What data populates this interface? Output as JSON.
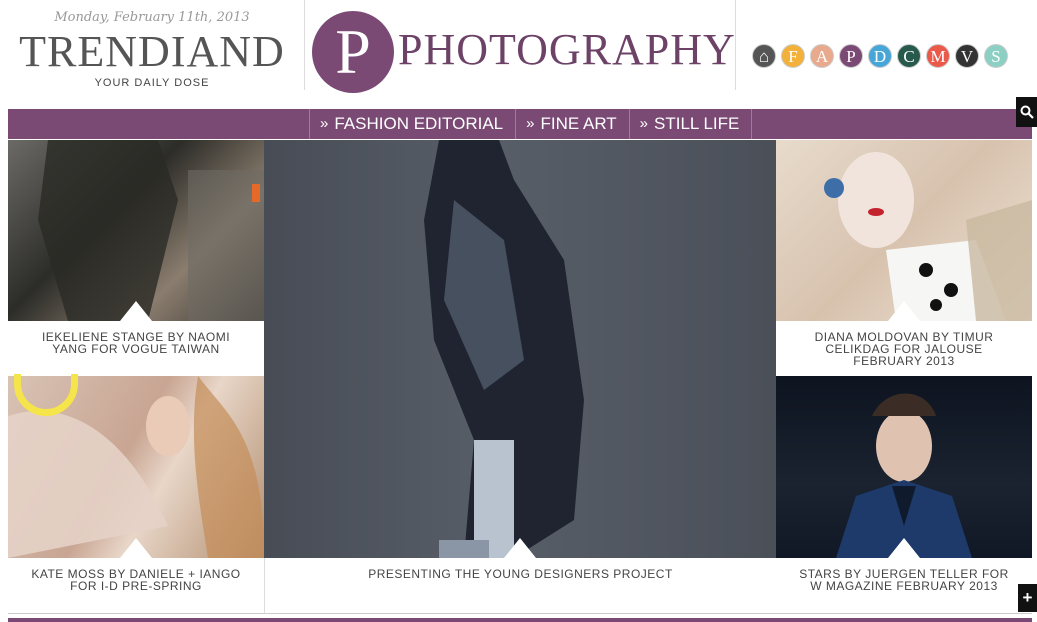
{
  "header": {
    "date": "Monday, February 11th, 2013",
    "brand": "TRENDIAND",
    "tagline": "YOUR DAILY DOSE",
    "section_letter": "P",
    "section_title": "PHOTOGRAPHY"
  },
  "category_icons": [
    {
      "letter": "⌂",
      "name": "home",
      "color": "#555555"
    },
    {
      "letter": "F",
      "name": "fashion",
      "color": "#f2b13b"
    },
    {
      "letter": "A",
      "name": "art",
      "color": "#e9a98c"
    },
    {
      "letter": "P",
      "name": "photography",
      "color": "#7a4a75"
    },
    {
      "letter": "D",
      "name": "design",
      "color": "#46a6d8"
    },
    {
      "letter": "C",
      "name": "culture",
      "color": "#275a4c"
    },
    {
      "letter": "M",
      "name": "music",
      "color": "#ea5a4a"
    },
    {
      "letter": "V",
      "name": "video",
      "color": "#333333"
    },
    {
      "letter": "S",
      "name": "style",
      "color": "#8cd0c4"
    }
  ],
  "nav": {
    "items": [
      {
        "label": "FASHION EDITORIAL"
      },
      {
        "label": "FINE ART"
      },
      {
        "label": "STILL LIFE"
      }
    ],
    "chevron": "»",
    "search_icon": "🔍",
    "accent": "#7a4a75"
  },
  "tiles": [
    {
      "caption": "IEKELIENE STANGE BY NAOMI YANG FOR VOGUE TAIWAN"
    },
    {
      "caption": "KATE MOSS BY DANIELE + IANGO FOR I-D PRE-SPRING"
    },
    {
      "caption": "PRESENTING THE YOUNG DESIGNERS PROJECT"
    },
    {
      "caption": "DIANA MOLDOVAN BY TIMUR CELIKDAG FOR JALOUSE FEBRUARY 2013"
    },
    {
      "caption": "STARS BY JUERGEN TELLER FOR W MAGAZINE FEBRUARY 2013"
    }
  ],
  "more_button": "+"
}
